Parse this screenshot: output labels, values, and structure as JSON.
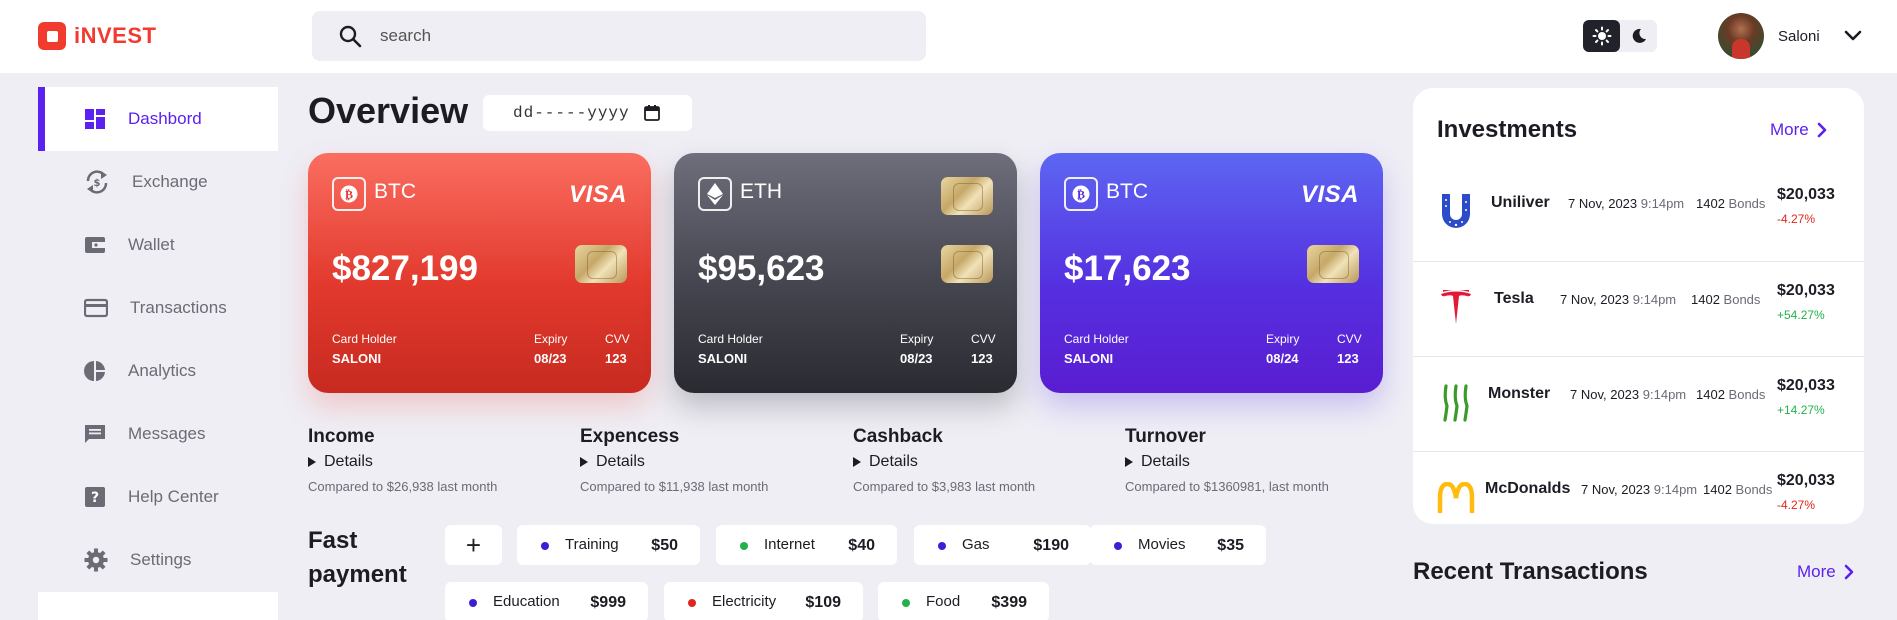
{
  "brand": {
    "logo_text": "iNVEST",
    "accent": "#5b21f0",
    "brand_red": "#f23b2f"
  },
  "search": {
    "placeholder": "search"
  },
  "user": {
    "name": "Saloni"
  },
  "sidebar": {
    "items": [
      {
        "label": "Dashbord",
        "icon": "dashboard-icon",
        "active": true
      },
      {
        "label": "Exchange",
        "icon": "exchange-icon"
      },
      {
        "label": "Wallet",
        "icon": "wallet-icon"
      },
      {
        "label": "Transactions",
        "icon": "card-icon"
      },
      {
        "label": "Analytics",
        "icon": "pie-chart-icon"
      },
      {
        "label": "Messages",
        "icon": "message-icon"
      },
      {
        "label": "Help Center",
        "icon": "help-icon"
      },
      {
        "label": "Settings",
        "icon": "gear-icon"
      }
    ]
  },
  "overview": {
    "title": "Overview",
    "date_placeholder": "dd-----yyyy"
  },
  "cards": [
    {
      "coin": "BTC",
      "network": "VISA",
      "amount": "$827,199",
      "holder_label": "Card Holder",
      "holder": "SALONI",
      "expiry_label": "Expiry",
      "expiry": "08/23",
      "cvv_label": "CVV",
      "cvv": "123"
    },
    {
      "coin": "ETH",
      "network": "",
      "amount": "$95,623",
      "holder_label": "Card Holder",
      "holder": "SALONI",
      "expiry_label": "Expiry",
      "expiry": "08/23",
      "cvv_label": "CVV",
      "cvv": "123"
    },
    {
      "coin": "BTC",
      "network": "VISA",
      "amount": "$17,623",
      "holder_label": "Card Holder",
      "holder": "SALONI",
      "expiry_label": "Expiry",
      "expiry": "08/24",
      "cvv_label": "CVV",
      "cvv": "123"
    }
  ],
  "stats": [
    {
      "title": "Income",
      "details": "Details",
      "compare": "Compared to $26,938 last month"
    },
    {
      "title": "Expencess",
      "details": "Details",
      "compare": "Compared to $11,938 last month"
    },
    {
      "title": "Cashback",
      "details": "Details",
      "compare": "Compared to $3,983 last month"
    },
    {
      "title": "Turnover",
      "details": "Details",
      "compare": "Compared to $1360981, last month"
    }
  ],
  "fast_payment": {
    "title_line1": "Fast",
    "title_line2": "payment",
    "add_label": "+",
    "items": [
      {
        "name": "Training",
        "amount": "$50",
        "dot": "#3b1fd6"
      },
      {
        "name": "Internet",
        "amount": "$40",
        "dot": "#22b14c"
      },
      {
        "name": "Gas",
        "amount": "$190",
        "dot": "#3b1fd6"
      },
      {
        "name": "Movies",
        "amount": "$35",
        "dot": "#3b1fd6"
      },
      {
        "name": "Education",
        "amount": "$999",
        "dot": "#3b1fd6"
      },
      {
        "name": "Electricity",
        "amount": "$109",
        "dot": "#e0261d"
      },
      {
        "name": "Food",
        "amount": "$399",
        "dot": "#22b14c"
      }
    ]
  },
  "investments": {
    "title": "Investments",
    "more": "More",
    "rows": [
      {
        "name": "Uniliver",
        "date": "7 Nov, 2023",
        "time": "9:14pm",
        "bonds_count": "1402",
        "bonds_label": "Bonds",
        "amount": "$20,033",
        "change": "-4.27%",
        "positive": false,
        "logo": "unilever-logo-icon"
      },
      {
        "name": "Tesla",
        "date": "7 Nov, 2023",
        "time": "9:14pm",
        "bonds_count": "1402",
        "bonds_label": "Bonds",
        "amount": "$20,033",
        "change": "+54.27%",
        "positive": true,
        "logo": "tesla-logo-icon"
      },
      {
        "name": "Monster",
        "date": "7 Nov, 2023",
        "time": "9:14pm",
        "bonds_count": "1402",
        "bonds_label": "Bonds",
        "amount": "$20,033",
        "change": "+14.27%",
        "positive": true,
        "logo": "monster-logo-icon"
      },
      {
        "name": "McDonalds",
        "date": "7 Nov, 2023",
        "time": "9:14pm",
        "bonds_count": "1402",
        "bonds_label": "Bonds",
        "amount": "$20,033",
        "change": "-4.27%",
        "positive": false,
        "logo": "mcdonalds-logo-icon"
      }
    ]
  },
  "recent_transactions": {
    "title": "Recent Transactions",
    "more": "More"
  },
  "colors": {
    "negative": "#e0261d",
    "positive": "#22b14c"
  }
}
